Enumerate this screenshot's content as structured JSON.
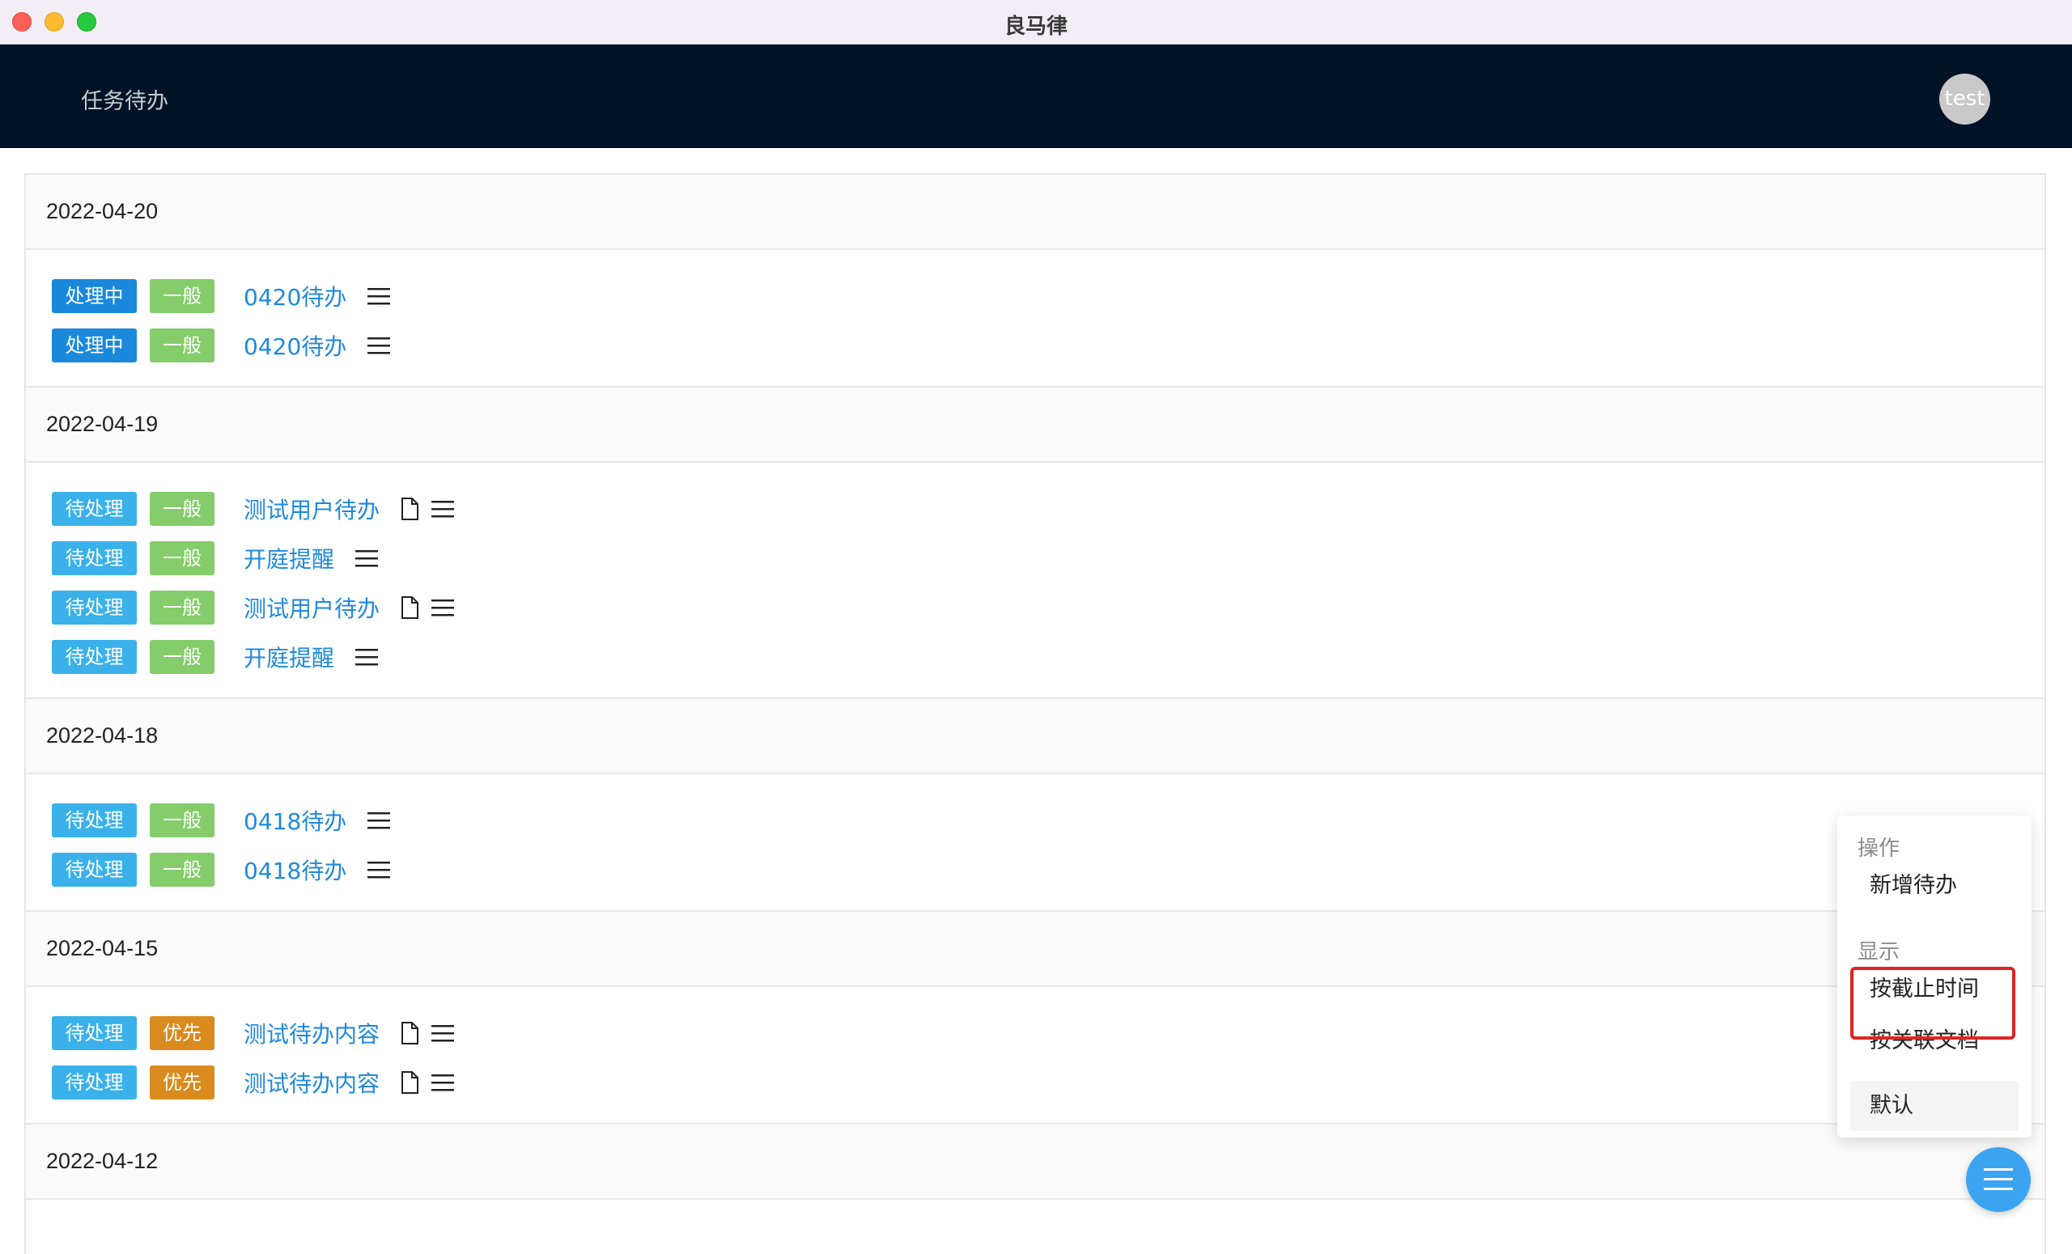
{
  "window": {
    "title": "良马律"
  },
  "header": {
    "title": "任务待办",
    "avatar_text": "test"
  },
  "groups": [
    {
      "date": "2022-04-20",
      "items": [
        {
          "status": "处理中",
          "status_type": "processing",
          "priority": "一般",
          "priority_type": "normal",
          "title": "0420待办",
          "has_doc": false
        },
        {
          "status": "处理中",
          "status_type": "processing",
          "priority": "一般",
          "priority_type": "normal",
          "title": "0420待办",
          "has_doc": false
        }
      ]
    },
    {
      "date": "2022-04-19",
      "items": [
        {
          "status": "待处理",
          "status_type": "pending",
          "priority": "一般",
          "priority_type": "normal",
          "title": "测试用户待办",
          "has_doc": true
        },
        {
          "status": "待处理",
          "status_type": "pending",
          "priority": "一般",
          "priority_type": "normal",
          "title": "开庭提醒",
          "has_doc": false
        },
        {
          "status": "待处理",
          "status_type": "pending",
          "priority": "一般",
          "priority_type": "normal",
          "title": "测试用户待办",
          "has_doc": true
        },
        {
          "status": "待处理",
          "status_type": "pending",
          "priority": "一般",
          "priority_type": "normal",
          "title": "开庭提醒",
          "has_doc": false
        }
      ]
    },
    {
      "date": "2022-04-18",
      "items": [
        {
          "status": "待处理",
          "status_type": "pending",
          "priority": "一般",
          "priority_type": "normal",
          "title": "0418待办",
          "has_doc": false
        },
        {
          "status": "待处理",
          "status_type": "pending",
          "priority": "一般",
          "priority_type": "normal",
          "title": "0418待办",
          "has_doc": false
        }
      ]
    },
    {
      "date": "2022-04-15",
      "items": [
        {
          "status": "待处理",
          "status_type": "pending",
          "priority": "优先",
          "priority_type": "priority",
          "title": "测试待办内容",
          "has_doc": true
        },
        {
          "status": "待处理",
          "status_type": "pending",
          "priority": "优先",
          "priority_type": "priority",
          "title": "测试待办内容",
          "has_doc": true
        }
      ]
    },
    {
      "date": "2022-04-12",
      "items": []
    }
  ],
  "popup": {
    "section_actions": "操作",
    "add_todo": "新增待办",
    "section_display": "显示",
    "by_deadline": "按截止时间",
    "by_document": "按关联文档",
    "default": "默认"
  },
  "colors": {
    "header_bg": "#011326",
    "link": "#1f89dc",
    "tag_processing": "#1a88db",
    "tag_pending": "#3ab1ea",
    "tag_normal": "#84cd6a",
    "tag_priority": "#d98b1e",
    "fab": "#3ba4f0",
    "highlight": "#e02424"
  },
  "icons": {
    "document": "document-icon",
    "menu": "menu-icon",
    "fab": "menu-icon"
  }
}
